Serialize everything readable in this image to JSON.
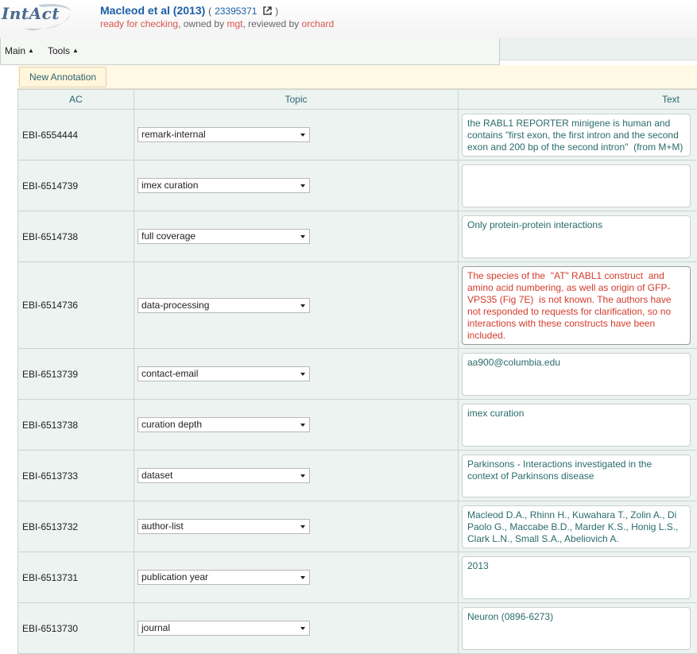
{
  "header": {
    "logo": "IntAct",
    "title": "Macleod et al (2013)",
    "pmid": "23395371",
    "paren_open": "(",
    "paren_close": ")",
    "status": "ready for checking",
    "owned_by_label": ", owned by",
    "owner": "mgt",
    "reviewed_by_label": ", reviewed by",
    "reviewer": "orchard"
  },
  "menu": {
    "main": "Main",
    "tools": "Tools"
  },
  "toolbar": {
    "new_annotation": "New Annotation"
  },
  "table": {
    "columns": {
      "ac": "AC",
      "topic": "Topic",
      "text": "Text"
    },
    "rows": [
      {
        "ac": "EBI-6554444",
        "topic": "remark-internal",
        "text": "the RABL1 REPORTER minigene is human and contains \"first exon, the first intron and the second exon and 200 bp of the second intron\"  (from M+M)"
      },
      {
        "ac": "EBI-6514739",
        "topic": "imex curation",
        "text": ""
      },
      {
        "ac": "EBI-6514738",
        "topic": "full coverage",
        "text": "Only protein-protein interactions"
      },
      {
        "ac": "EBI-6514736",
        "topic": "data-processing",
        "text": "The species of the  \"AT\" RABL1 construct  and amino acid numbering, as well as origin of GFP-VPS35 (Fig 7E)  is not known. The authors have not responded to requests for clarification, so no interactions with these constructs have been included."
      },
      {
        "ac": "EBI-6513739",
        "topic": "contact-email",
        "text": "aa900@columbia.edu"
      },
      {
        "ac": "EBI-6513738",
        "topic": "curation depth",
        "text": "imex curation"
      },
      {
        "ac": "EBI-6513733",
        "topic": "dataset",
        "text": "Parkinsons - Interactions investigated in the context of Parkinsons disease"
      },
      {
        "ac": "EBI-6513732",
        "topic": "author-list",
        "text": "Macleod D.A., Rhinn H., Kuwahara T., Zolin A., Di Paolo G., Maccabe B.D., Marder K.S., Honig L.S., Clark L.N., Small S.A., Abeliovich A."
      },
      {
        "ac": "EBI-6513731",
        "topic": "publication year",
        "text": "2013"
      },
      {
        "ac": "EBI-6513730",
        "topic": "journal",
        "text": "Neuron (0896-6273)"
      }
    ]
  },
  "colors": {
    "title": "#1d5fa8",
    "status_red": "#d9534f",
    "teal_text": "#2a6b6b",
    "alert_text": "#d23c2c",
    "row_bg": "#ecf3f1"
  }
}
